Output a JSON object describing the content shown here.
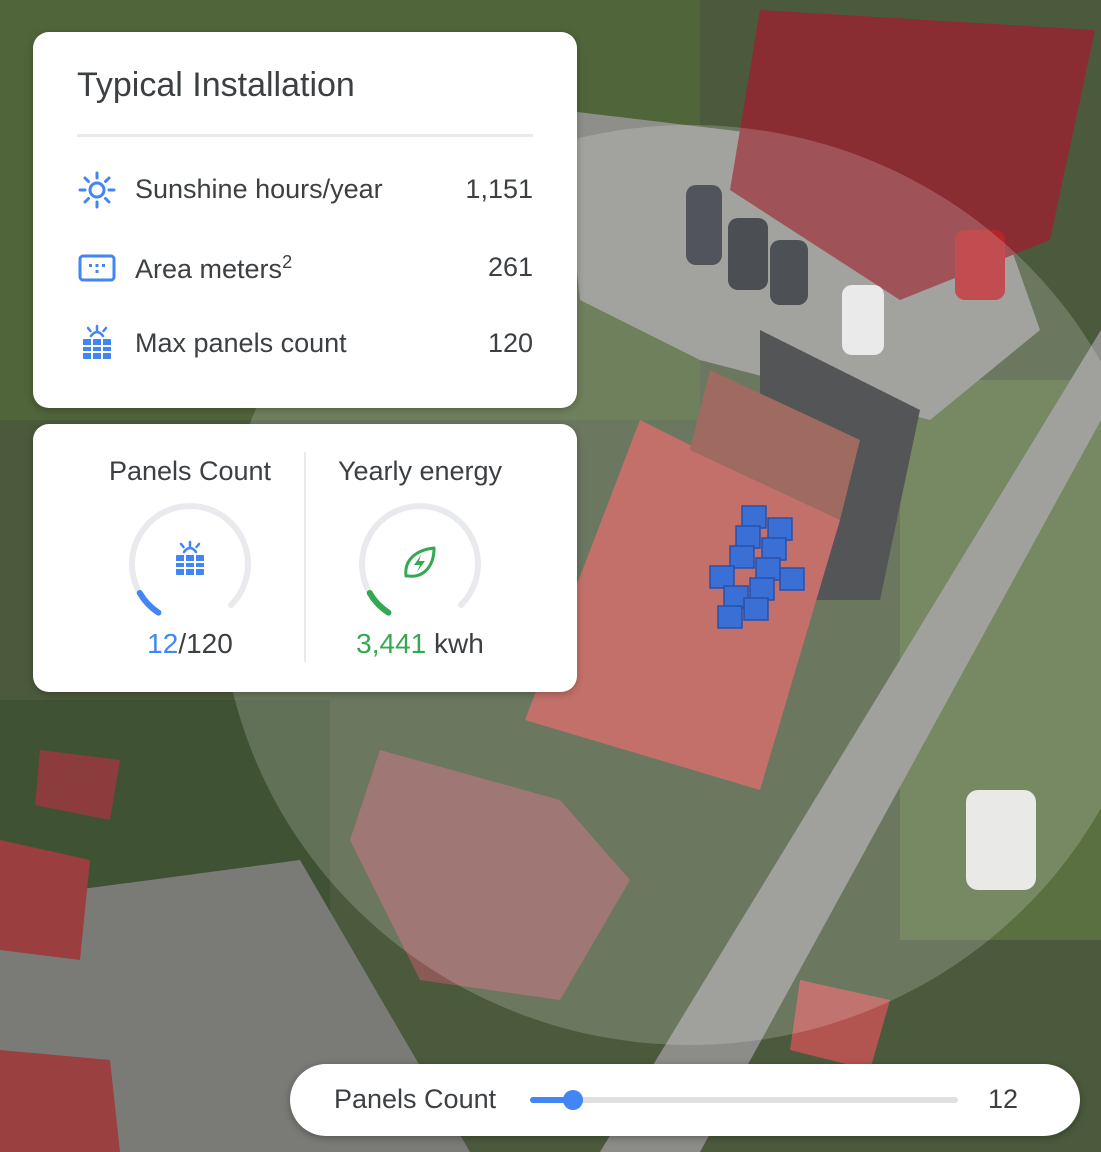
{
  "info_card": {
    "title": "Typical Installation",
    "stats": [
      {
        "icon": "sun-icon",
        "label": "Sunshine hours/year",
        "value": "1,151"
      },
      {
        "icon": "area-icon",
        "label": "Area meters",
        "label_sup": "2",
        "value": "261"
      },
      {
        "icon": "solar-panel-icon",
        "label": "Max panels count",
        "value": "120"
      }
    ]
  },
  "gauges": {
    "panels": {
      "title": "Panels Count",
      "current": "12",
      "max": "/120",
      "fraction": 0.1,
      "color": "#4285f4",
      "icon": "solar-panel-icon"
    },
    "energy": {
      "title": "Yearly energy",
      "value": "3,441",
      "unit": " kwh",
      "fraction": 0.1,
      "color": "#34a853",
      "icon": "eco-bolt-icon"
    }
  },
  "slider": {
    "label": "Panels Count",
    "value": "12",
    "fraction": 0.1
  },
  "colors": {
    "accent": "#4285f4",
    "energy": "#34a853",
    "panel_fill": "#2f6fe0"
  }
}
